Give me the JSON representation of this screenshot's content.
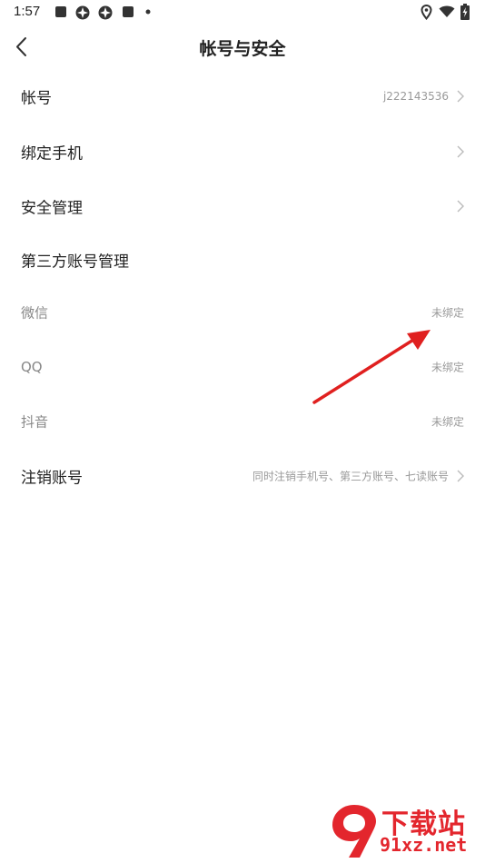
{
  "status_bar": {
    "time": "1:57",
    "left_icons": [
      "notification-square-icon",
      "app-icon",
      "app-icon",
      "notification-square-icon",
      "dot-icon"
    ],
    "right_icons": [
      "location-icon",
      "wifi-icon",
      "battery-charging-icon"
    ]
  },
  "header": {
    "title": "帐号与安全",
    "back_icon": "chevron-left-icon"
  },
  "rows": [
    {
      "label": "帐号",
      "value": "j222143536",
      "chevron": true
    },
    {
      "label": "绑定手机",
      "value": "",
      "chevron": true
    },
    {
      "label": "安全管理",
      "value": "",
      "chevron": true
    },
    {
      "label": "第三方账号管理",
      "value": "",
      "chevron": false
    },
    {
      "label": "微信",
      "value": "未绑定",
      "chevron": false
    },
    {
      "label": "QQ",
      "value": "未绑定",
      "chevron": false
    },
    {
      "label": "抖音",
      "value": "未绑定",
      "chevron": false
    },
    {
      "label": "注销账号",
      "value": "同时注销手机号、第三方账号、七读账号",
      "chevron": true
    }
  ],
  "annotation": {
    "color": "#e0201f"
  },
  "watermark": {
    "title": "下载站",
    "site": "91xz.net",
    "color": "#e3262d"
  }
}
